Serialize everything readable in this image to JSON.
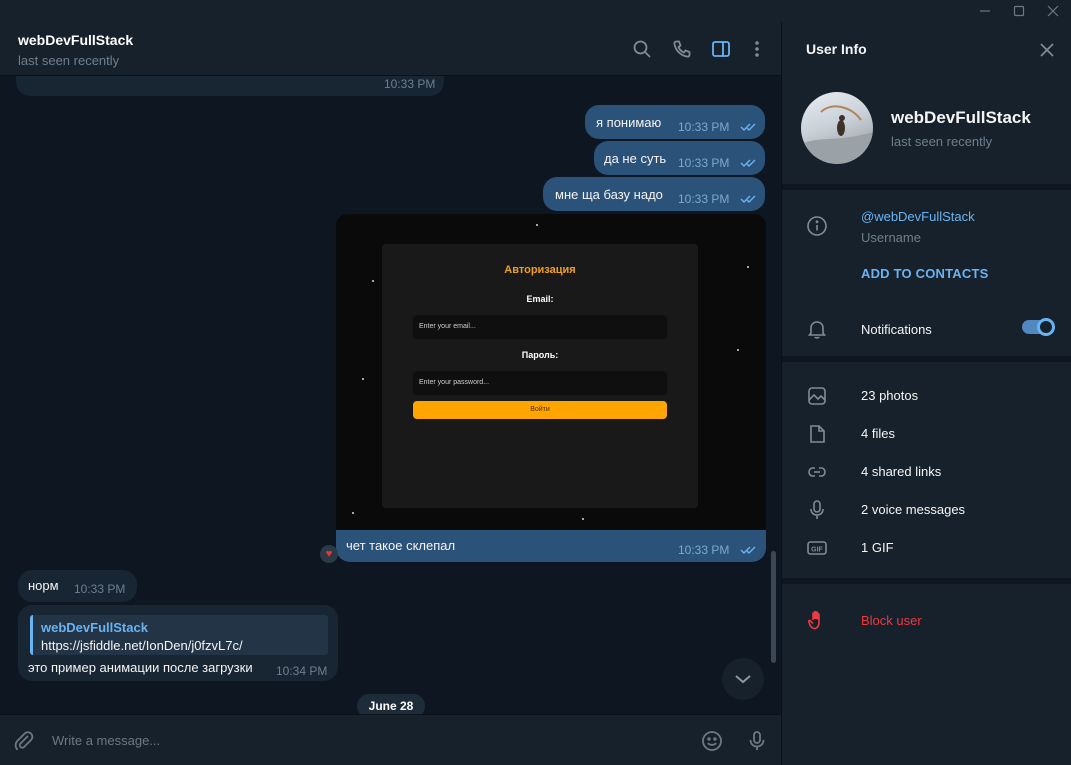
{
  "chat": {
    "name": "webDevFullStack",
    "status": "last seen recently"
  },
  "messages": [
    {
      "type": "in",
      "time": "10:33 PM"
    },
    {
      "type": "out",
      "text": "я понимаю",
      "time": "10:33 PM"
    },
    {
      "type": "out",
      "text": "да не суть",
      "time": "10:33 PM"
    },
    {
      "type": "out",
      "text": "мне ща базу надо",
      "time": "10:33 PM"
    },
    {
      "type": "out-photo",
      "caption": "чет такое склепал",
      "time": "10:33 PM",
      "reaction": "heart"
    },
    {
      "type": "in",
      "text": "норм",
      "time": "10:33 PM"
    },
    {
      "type": "in",
      "reply_name": "webDevFullStack",
      "reply_text": "https://jsfiddle.net/IonDen/j0fzvL7c/",
      "text": "это пример анимации после загрузки",
      "time": "10:34 PM"
    }
  ],
  "photo": {
    "title": "Авторизация",
    "email_label": "Email:",
    "email_placeholder": "Enter your email...",
    "password_label": "Пароль:",
    "password_placeholder": "Enter your password...",
    "button": "Войти"
  },
  "date_separator": "June 28",
  "composer": {
    "placeholder": "Write a message..."
  },
  "panel": {
    "title": "User Info",
    "name": "webDevFullStack",
    "status": "last seen recently",
    "username": "@webDevFullStack",
    "username_label": "Username",
    "add_contact": "ADD TO CONTACTS",
    "notifications": "Notifications",
    "notifications_on": true,
    "media": {
      "photos": "23 photos",
      "files": "4 files",
      "links": "4 shared links",
      "voice": "2 voice messages",
      "gif": "1 GIF"
    },
    "block": "Block user"
  },
  "colors": {
    "accent": "#6ab3f3",
    "outgoing_bubble": "#2b5278",
    "incoming_bubble": "#182533",
    "danger": "#ec3942"
  }
}
